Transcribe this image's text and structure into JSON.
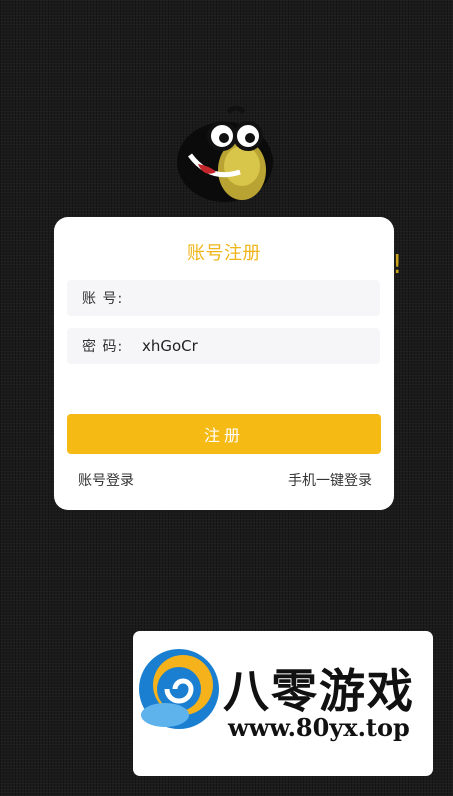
{
  "background_exclaim": "!",
  "register": {
    "title": "账号注册",
    "account_label": "账 号:",
    "account_value": "",
    "password_label": "密 码:",
    "password_value": "xhGoCr",
    "submit_label": "注册",
    "account_login_link": "账号登录",
    "phone_login_link": "手机一键登录"
  },
  "watermark": {
    "name": "八零游戏",
    "url": "www.80yx.top"
  },
  "colors": {
    "accent": "#f5ba14",
    "title": "#f0b51a",
    "background": "#1b1b1b",
    "field_bg": "#f6f5f8"
  },
  "icons": {
    "mascot": "mascot-logo-icon",
    "watermark_logo": "swirl-logo-icon"
  }
}
